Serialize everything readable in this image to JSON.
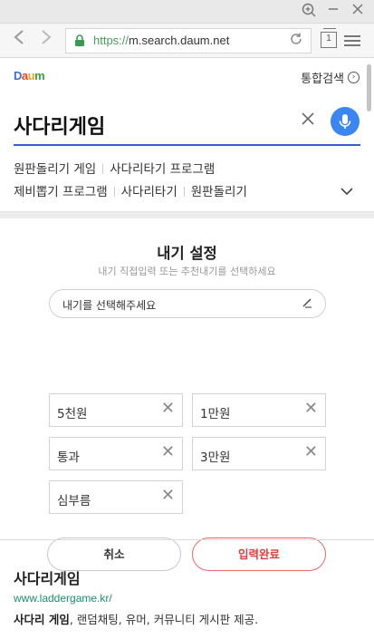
{
  "browser": {
    "url_protocol": "https://",
    "url_host": "m.search.daum.net",
    "tab_count": "1",
    "zoom_icon": "magnifier-plus-icon",
    "minimize_icon": "minus-icon",
    "close_icon": "close-icon"
  },
  "header": {
    "logo_parts": [
      "D",
      "a",
      "u",
      "m"
    ],
    "unified_search_label": "통합검색"
  },
  "search": {
    "query": "사다리게임"
  },
  "related": {
    "row1": [
      "원판돌리기 게임",
      "사다리타기 프로그램"
    ],
    "row2": [
      "제비뽑기 프로그램",
      "사다리타기",
      "원판돌리기"
    ]
  },
  "bet_settings": {
    "title": "내기 설정",
    "subtitle": "내기 직접입력 또는 추천내기를 선택하세요",
    "select_placeholder": "내기를 선택해주세요",
    "items": [
      "5천원",
      "1만원",
      "통과",
      "3만원",
      "심부름"
    ],
    "cancel_label": "취소",
    "done_label": "입력완료"
  },
  "result": {
    "title": "사다리게임",
    "url": "www.laddergame.kr/",
    "desc_bold": "사다리 게임",
    "desc_rest": ", 랜덤채팅, 유머, 커뮤니티 게시판 제공."
  },
  "colors": {
    "accent_blue": "#3b86f2",
    "confirm_red": "#e0413e",
    "link_green": "#1b8f6a"
  }
}
